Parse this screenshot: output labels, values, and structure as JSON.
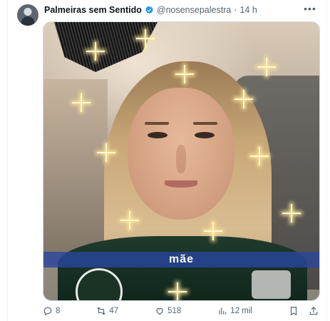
{
  "tweet": {
    "display_name": "Palmeiras sem Sentido",
    "handle": "@nosensepalestra",
    "separator": "·",
    "time": "14 h"
  },
  "media": {
    "caption": "mãe"
  },
  "actions": {
    "replies": "8",
    "retweets": "47",
    "likes": "518",
    "views": "12 mil"
  },
  "colors": {
    "text_primary": "#0f1419",
    "text_secondary": "#536471",
    "verified_blue": "#1d9bf0",
    "caption_band": "#2846a0"
  }
}
